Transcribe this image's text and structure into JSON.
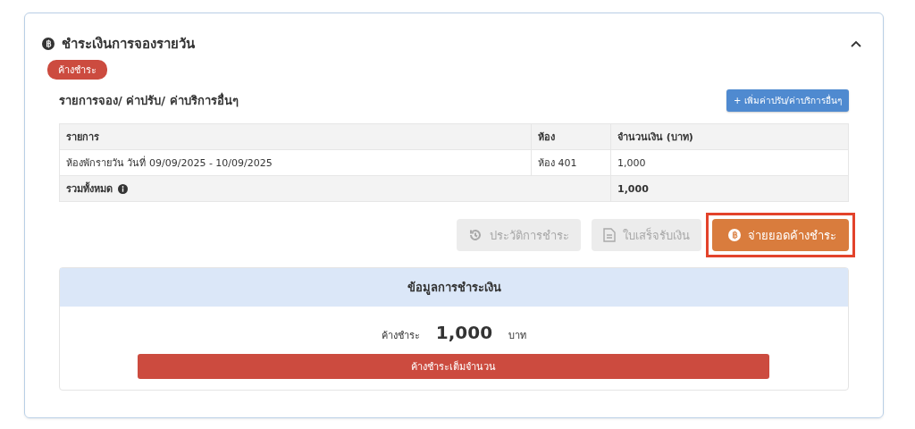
{
  "card": {
    "title": "ชำระเงินการจองรายวัน",
    "expanded": true,
    "status_badge": "ค้างชำระ"
  },
  "items_section": {
    "title": "รายการจอง/ ค่าปรับ/ ค่าบริการอื่นๆ",
    "add_button": "+ เพิ่มค่าปรับ/ค่าบริการอื่นๆ"
  },
  "table": {
    "columns": [
      "รายการ",
      "ห้อง",
      "จำนวนเงิน (บาท)"
    ],
    "rows": [
      [
        "ห้องพักรายวัน วันที่ 09/09/2025 - 10/09/2025",
        "ห้อง 401",
        "1,000"
      ]
    ],
    "total": {
      "label": "รวมทั้งหมด",
      "amount": "1,000"
    }
  },
  "actions": [
    {
      "label": "ประวัติการชำระ",
      "kind": "history",
      "disabled": true,
      "highlighted": false
    },
    {
      "label": "ใบเสร็จรับเงิน",
      "kind": "receipt",
      "disabled": true,
      "highlighted": false
    },
    {
      "label": "จ่ายยอดค้างชำระ",
      "kind": "pay",
      "disabled": false,
      "highlighted": true
    }
  ],
  "payment_info": {
    "title": "ข้อมูลการชำระเงิน",
    "status_label": "ค้างชำระ",
    "amount": "1,000",
    "currency": "บาท",
    "status_bar": "ค้างชำระเต็มจำนวน"
  }
}
